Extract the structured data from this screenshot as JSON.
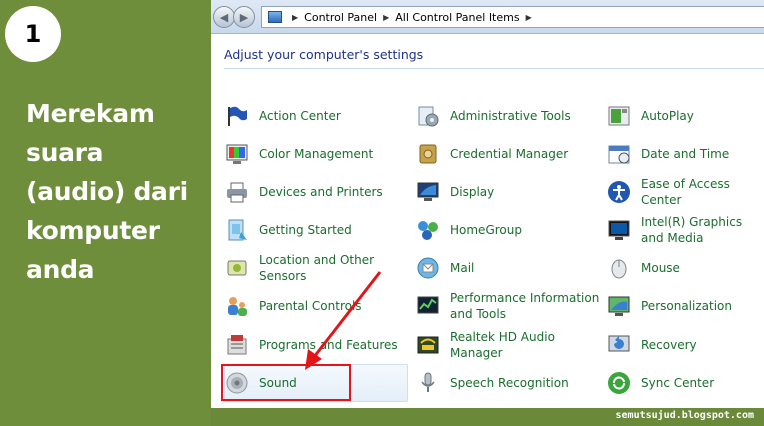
{
  "step": {
    "number": "1"
  },
  "headline": {
    "lines": [
      "Merekam",
      "suara",
      "(audio) dari",
      "komputer",
      "anda"
    ]
  },
  "address_bar": {
    "breadcrumbs": [
      "Control Panel",
      "All Control Panel Items"
    ]
  },
  "window": {
    "title": "Adjust your computer's settings"
  },
  "items": {
    "col1": [
      {
        "label": "Action Center",
        "icon": "flag-icon"
      },
      {
        "label": "Color Management",
        "icon": "color-management-icon"
      },
      {
        "label": "Devices and Printers",
        "icon": "printer-icon"
      },
      {
        "label": "Getting Started",
        "icon": "getting-started-icon"
      },
      {
        "label": "Location and Other Sensors",
        "icon": "sensor-icon"
      },
      {
        "label": "Parental Controls",
        "icon": "parental-controls-icon"
      },
      {
        "label": "Programs and Features",
        "icon": "programs-icon"
      },
      {
        "label": "Sound",
        "icon": "speaker-icon"
      }
    ],
    "col2": [
      {
        "label": "Administrative Tools",
        "icon": "admin-tools-icon"
      },
      {
        "label": "Credential Manager",
        "icon": "vault-icon"
      },
      {
        "label": "Display",
        "icon": "monitor-icon"
      },
      {
        "label": "HomeGroup",
        "icon": "homegroup-icon"
      },
      {
        "label": "Mail",
        "icon": "mail-icon"
      },
      {
        "label": "Performance Information and Tools",
        "icon": "performance-icon"
      },
      {
        "label": "Realtek HD Audio Manager",
        "icon": "realtek-icon"
      },
      {
        "label": "Speech Recognition",
        "icon": "microphone-icon"
      }
    ],
    "col3": [
      {
        "label": "AutoPlay",
        "icon": "autoplay-icon"
      },
      {
        "label": "Date and Time",
        "icon": "calendar-icon"
      },
      {
        "label": "Ease of Access Center",
        "icon": "accessibility-icon"
      },
      {
        "label": "Intel(R) Graphics and Media",
        "icon": "intel-graphics-icon"
      },
      {
        "label": "Mouse",
        "icon": "mouse-icon"
      },
      {
        "label": "Personalization",
        "icon": "personalization-icon"
      },
      {
        "label": "Recovery",
        "icon": "recovery-icon"
      },
      {
        "label": "Sync Center",
        "icon": "sync-icon"
      }
    ]
  },
  "footer": {
    "credit": "semutsujud.blogspot.com"
  },
  "colors": {
    "background_green": "#6e8e3c",
    "link_green": "#1a6d2d",
    "title_blue": "#1e3287",
    "highlight_red": "#e3141a"
  }
}
